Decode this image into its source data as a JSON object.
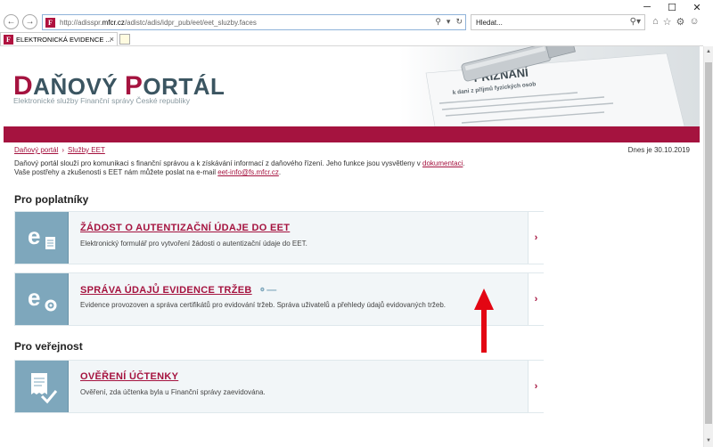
{
  "window": {
    "controls": [
      "─",
      "☐",
      "✕"
    ]
  },
  "browser": {
    "back_icon": "back-icon",
    "forward_icon": "forward-icon",
    "favicon_letter": "F",
    "url_prefix": "http://adisspr.",
    "url_domain": "mfcr.cz",
    "url_path": "/adistc/adis/idpr_pub/eet/eet_sluzby.faces",
    "search_placeholder": "Hledat...",
    "tab_title": "ELEKTRONICKÁ EVIDENCE ...",
    "tab_close": "×"
  },
  "header": {
    "logo_first_initial": "D",
    "logo_first_rest": "AŇOVÝ ",
    "logo_second_initial": "P",
    "logo_second_rest": "ORTÁL",
    "tagline": "Elektronické služby Finanční správy České republiky",
    "image_text_title": "PŘIZNÁNÍ",
    "image_text_sub": "k dani z příjmů fyzických osob"
  },
  "breadcrumb": {
    "items": [
      "Daňový portál",
      "Služby EET"
    ],
    "separator": "›"
  },
  "date": "Dnes je 30.10.2019",
  "intro": {
    "line1_text": "Daňový portál slouží pro komunikaci s finanční správou a k získávání informací z daňového řízení. Jeho funkce jsou vysvětleny v ",
    "line1_link": "dokumentaci",
    "line1_end": ".",
    "line2_text": "Vaše postřehy a zkušenosti s EET nám můžete poslat na e-mail ",
    "line2_link": "eet-info@fs.mfcr.cz",
    "line2_end": "."
  },
  "sections": {
    "taxpayers_heading": "Pro poplatníky",
    "public_heading": "Pro veřejnost"
  },
  "cards": [
    {
      "title": "ŽÁDOST O AUTENTIZAČNÍ ÚDAJE DO EET",
      "description": "Elektronický formulář pro vytvoření žádosti o autentizační údaje do EET.",
      "chevron": "›"
    },
    {
      "title": "SPRÁVA ÚDAJŮ EVIDENCE TRŽEB",
      "description": "Evidence provozoven a správa certifikátů pro evidování tržeb. Správa uživatelů a přehledy údajů evidovaných tržeb.",
      "chevron": "›"
    },
    {
      "title": "OVĚŘENÍ ÚČTENKY",
      "description": "Ověření, zda účtenka byla u Finanční správy zaevidována.",
      "chevron": "›"
    }
  ],
  "colors": {
    "brand_red": "#a5133f",
    "tile_blue": "#7ea7bc",
    "logo_slate": "#3b5561",
    "annotation_arrow": "#e30613"
  }
}
